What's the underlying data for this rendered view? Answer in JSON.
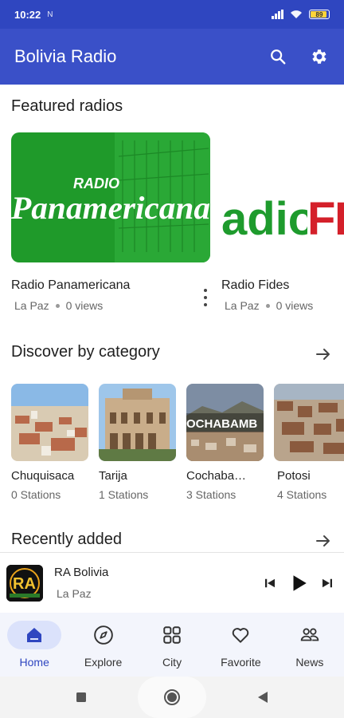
{
  "status_bar": {
    "time": "10:22",
    "notification": "N",
    "battery": "89"
  },
  "app_bar": {
    "title": "Bolivia Radio",
    "icons": [
      "search-icon",
      "gear-icon"
    ]
  },
  "featured": {
    "title": "Featured radios",
    "items": [
      {
        "name": "Radio Panamericana",
        "city": "La Paz",
        "views": "0 views",
        "logo_small": "RADIO",
        "logo_big": "Panamericana"
      },
      {
        "name": "Radio Fides",
        "city": "La Paz",
        "views": "0 views",
        "logo_big": "adioFi"
      }
    ]
  },
  "categories": {
    "title": "Discover by category",
    "items": [
      {
        "name": "Chuquisaca",
        "count": "0 Stations"
      },
      {
        "name": "Tarija",
        "count": "1 Stations"
      },
      {
        "name": "Cochaba…",
        "count": "3 Stations",
        "overlay": "OCHABAMB"
      },
      {
        "name": "Potosi",
        "count": "4 Stations"
      }
    ]
  },
  "recent": {
    "title": "Recently added"
  },
  "player": {
    "title": "RA Bolivia",
    "subtitle": "La Paz",
    "logo_text": "RA"
  },
  "bottom_nav": {
    "items": [
      {
        "label": "Home",
        "icon": "home-icon",
        "active": true
      },
      {
        "label": "Explore",
        "icon": "compass-icon",
        "active": false
      },
      {
        "label": "City",
        "icon": "grid-icon",
        "active": false
      },
      {
        "label": "Favorite",
        "icon": "heart-icon",
        "active": false
      },
      {
        "label": "News",
        "icon": "people-icon",
        "active": false
      }
    ]
  },
  "colors": {
    "primary": "#3a50c8",
    "status_bar": "#2f46c0",
    "nav_bg": "#f3f5fc",
    "active_pill": "#dbe2fb"
  }
}
